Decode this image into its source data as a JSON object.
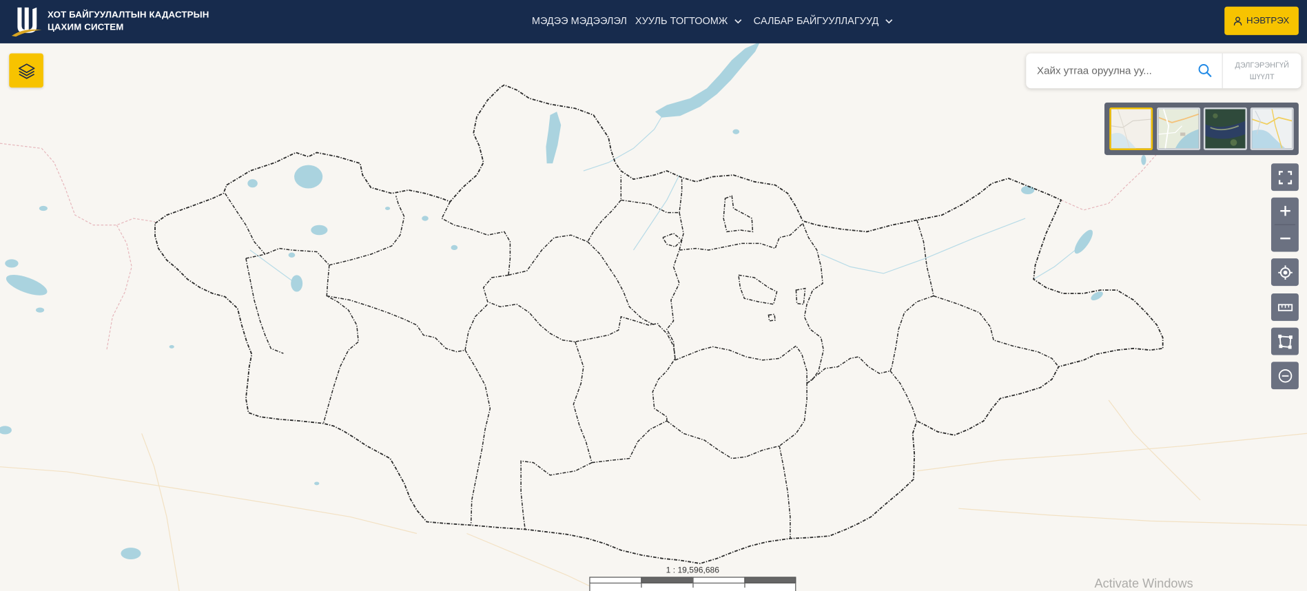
{
  "app": {
    "logo": "city-cadastre-logo",
    "title_line1": "ХОТ БАЙГУУЛАЛТЫН КАДАСТРЫН",
    "title_line2": "ЦАХИМ СИСТЕМ"
  },
  "nav": {
    "items": [
      {
        "label": "МЭДЭЭ МЭДЭЭЛЭЛ",
        "has_dropdown": false
      },
      {
        "label": "ХУУЛЬ ТОГТООМЖ",
        "has_dropdown": true,
        "icon": "chevron-down-icon"
      },
      {
        "label": "САЛБАР БАЙГУУЛЛАГУУД",
        "has_dropdown": true,
        "icon": "chevron-down-icon"
      }
    ]
  },
  "login": {
    "label": "НЭВТРЭХ",
    "icon": "user-icon"
  },
  "layers_button": {
    "icon": "layers-icon"
  },
  "search": {
    "placeholder": "Хайх утгаа оруулна уу...",
    "value": "",
    "icon": "search-icon",
    "advanced_line1": "ДЭЛГЭРЭНГҮЙ",
    "advanced_line2": "ШҮҮЛТ"
  },
  "basemaps": {
    "selected": 0,
    "options": [
      {
        "thumbnail": "light-basemap-thumbnail"
      },
      {
        "thumbnail": "streets-basemap-thumbnail"
      },
      {
        "thumbnail": "satellite-basemap-thumbnail"
      },
      {
        "thumbnail": "topo-basemap-thumbnail"
      }
    ]
  },
  "map_tools": [
    {
      "icon": "fullscreen-icon"
    },
    {
      "icon": "zoom-in-icon"
    },
    {
      "icon": "zoom-out-icon"
    },
    {
      "icon": "locate-icon"
    },
    {
      "icon": "measure-ruler-icon"
    },
    {
      "icon": "draw-polygon-icon"
    },
    {
      "icon": "clear-icon"
    }
  ],
  "scale": {
    "ratio_text": "1 : 19,596,686"
  },
  "watermark": {
    "text": "Activate Windows"
  },
  "colors": {
    "header_bg": "#172b4d",
    "accent": "#f7c300",
    "tool_bg": "#6b7181",
    "map_bg": "#f8f6f2",
    "water": "#aad3df",
    "boundary": "#2a2a2a",
    "search_icon": "#1e88e5"
  }
}
